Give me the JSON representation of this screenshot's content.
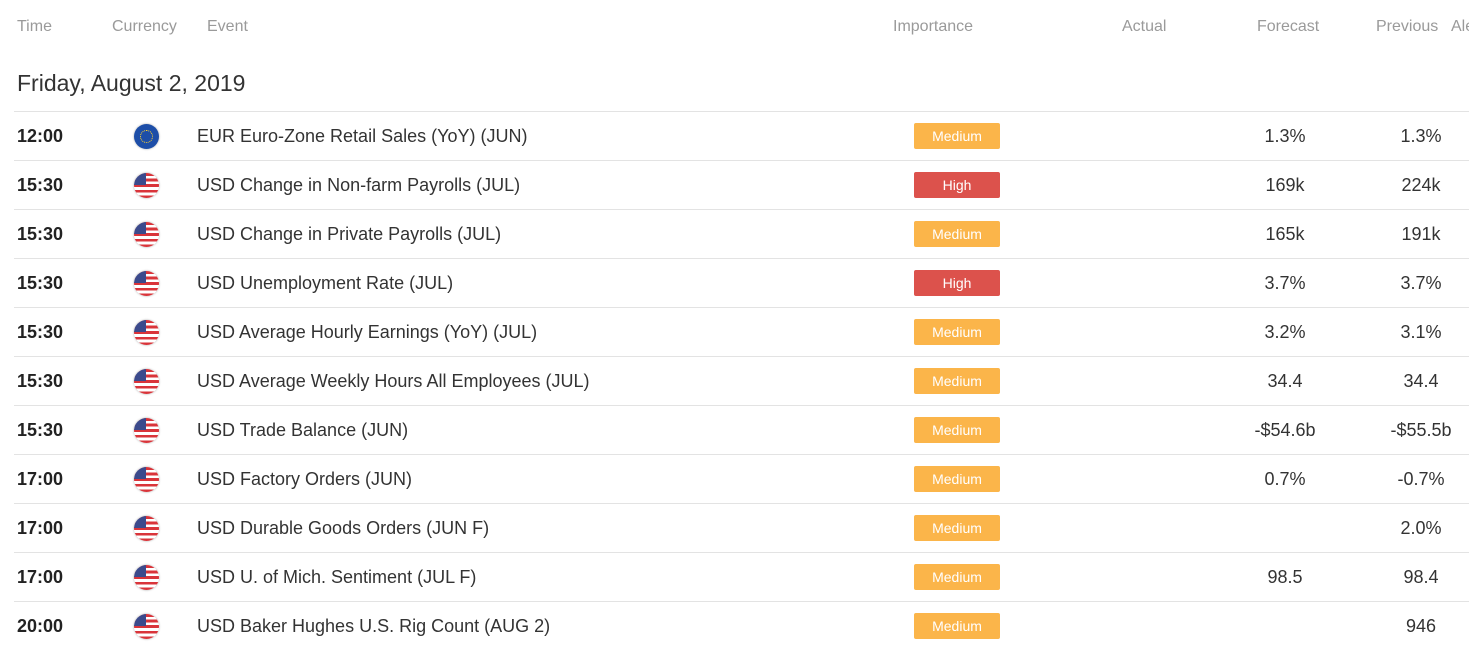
{
  "headers": {
    "time": "Time",
    "currency": "Currency",
    "event": "Event",
    "importance": "Importance",
    "actual": "Actual",
    "forecast": "Forecast",
    "previous": "Previous",
    "alert": "Ale"
  },
  "date_heading": "Friday, August 2, 2019",
  "colors": {
    "medium": "#fbb54a",
    "high": "#dc524c"
  },
  "events": [
    {
      "time": "12:00",
      "currency_flag": "eu-flag-icon",
      "event": "EUR Euro-Zone Retail Sales (YoY) (JUN)",
      "importance": "Medium",
      "actual": "",
      "forecast": "1.3%",
      "previous": "1.3%"
    },
    {
      "time": "15:30",
      "currency_flag": "us-flag-icon",
      "event": "USD Change in Non-farm Payrolls (JUL)",
      "importance": "High",
      "actual": "",
      "forecast": "169k",
      "previous": "224k"
    },
    {
      "time": "15:30",
      "currency_flag": "us-flag-icon",
      "event": "USD Change in Private Payrolls (JUL)",
      "importance": "Medium",
      "actual": "",
      "forecast": "165k",
      "previous": "191k"
    },
    {
      "time": "15:30",
      "currency_flag": "us-flag-icon",
      "event": "USD Unemployment Rate (JUL)",
      "importance": "High",
      "actual": "",
      "forecast": "3.7%",
      "previous": "3.7%"
    },
    {
      "time": "15:30",
      "currency_flag": "us-flag-icon",
      "event": "USD Average Hourly Earnings (YoY) (JUL)",
      "importance": "Medium",
      "actual": "",
      "forecast": "3.2%",
      "previous": "3.1%"
    },
    {
      "time": "15:30",
      "currency_flag": "us-flag-icon",
      "event": "USD Average Weekly Hours All Employees (JUL)",
      "importance": "Medium",
      "actual": "",
      "forecast": "34.4",
      "previous": "34.4"
    },
    {
      "time": "15:30",
      "currency_flag": "us-flag-icon",
      "event": "USD Trade Balance (JUN)",
      "importance": "Medium",
      "actual": "",
      "forecast": "-$54.6b",
      "previous": "-$55.5b"
    },
    {
      "time": "17:00",
      "currency_flag": "us-flag-icon",
      "event": "USD Factory Orders (JUN)",
      "importance": "Medium",
      "actual": "",
      "forecast": "0.7%",
      "previous": "-0.7%"
    },
    {
      "time": "17:00",
      "currency_flag": "us-flag-icon",
      "event": "USD Durable Goods Orders (JUN F)",
      "importance": "Medium",
      "actual": "",
      "forecast": "",
      "previous": "2.0%"
    },
    {
      "time": "17:00",
      "currency_flag": "us-flag-icon",
      "event": "USD U. of Mich. Sentiment (JUL F)",
      "importance": "Medium",
      "actual": "",
      "forecast": "98.5",
      "previous": "98.4"
    },
    {
      "time": "20:00",
      "currency_flag": "us-flag-icon",
      "event": "USD Baker Hughes U.S. Rig Count (AUG 2)",
      "importance": "Medium",
      "actual": "",
      "forecast": "",
      "previous": "946"
    }
  ]
}
